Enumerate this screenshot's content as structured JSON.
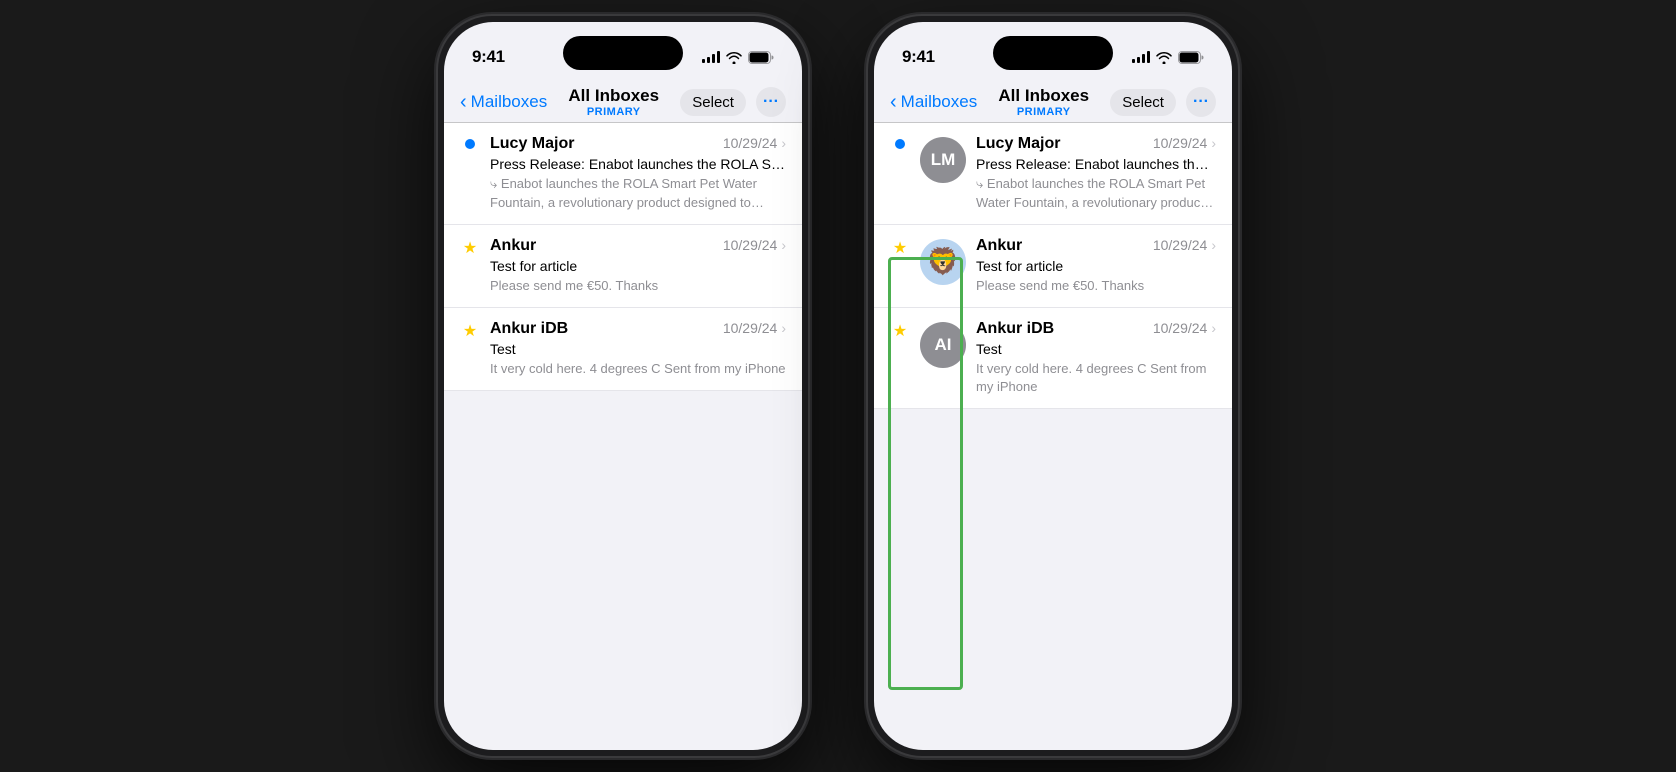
{
  "phones": {
    "left": {
      "time": "9:41",
      "nav": {
        "back_label": "Mailboxes",
        "title": "All Inboxes",
        "subtitle": "PRIMARY",
        "select_btn": "Select"
      },
      "emails": [
        {
          "id": "lucy",
          "sender": "Lucy Major",
          "date": "10/29/24",
          "subject": "Press Release: Enabot launches the ROLA Smart Pet...",
          "preview": "Enabot launches the ROLA Smart Pet Water Fountain, a revolutionary product designed to ensure...",
          "unread": true,
          "starred": false,
          "avatar": null
        },
        {
          "id": "ankur",
          "sender": "Ankur",
          "date": "10/29/24",
          "subject": "Test for article",
          "preview": "Please send me €50. Thanks",
          "unread": false,
          "starred": true,
          "avatar": null
        },
        {
          "id": "ankur-idb",
          "sender": "Ankur iDB",
          "date": "10/29/24",
          "subject": "Test",
          "preview": "It very cold here. 4 degrees C Sent from my iPhone",
          "unread": false,
          "starred": true,
          "avatar": null
        }
      ]
    },
    "right": {
      "time": "9:41",
      "nav": {
        "back_label": "Mailboxes",
        "title": "All Inboxes",
        "subtitle": "PRIMARY",
        "select_btn": "Select"
      },
      "emails": [
        {
          "id": "lucy-r",
          "sender": "Lucy Major",
          "date": "10/29/24",
          "subject": "Press Release: Enabot launches the ROLA Sm...",
          "preview": "Enabot launches the ROLA Smart Pet Water Fountain, a revolutionary product designed to...",
          "unread": true,
          "starred": false,
          "avatar": "LM",
          "avatar_class": "avatar-lm"
        },
        {
          "id": "ankur-r",
          "sender": "Ankur",
          "date": "10/29/24",
          "subject": "Test for article",
          "preview": "Please send me €50. Thanks",
          "unread": false,
          "starred": true,
          "avatar": "🦁",
          "avatar_class": "avatar-lion"
        },
        {
          "id": "ankur-idb-r",
          "sender": "Ankur iDB",
          "date": "10/29/24",
          "subject": "Test",
          "preview": "It very cold here. 4 degrees C Sent from my iPhone",
          "unread": false,
          "starred": true,
          "avatar": "AI",
          "avatar_class": "avatar-ai"
        }
      ]
    }
  }
}
